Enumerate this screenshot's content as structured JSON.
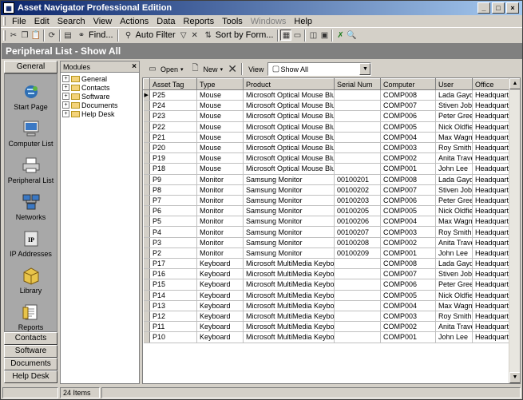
{
  "window": {
    "title": "Asset Navigator Professional Edition",
    "min": "_",
    "max": "□",
    "close": "×"
  },
  "menu": [
    "File",
    "Edit",
    "Search",
    "View",
    "Actions",
    "Data",
    "Reports",
    "Tools",
    "Windows",
    "Help"
  ],
  "toolbar": {
    "find": "Find...",
    "auto_filter": "Auto Filter",
    "sort_by_form": "Sort by Form..."
  },
  "header": {
    "title": "Peripheral List - Show All"
  },
  "leftbar": {
    "top_tab": "General",
    "items": [
      "Start Page",
      "Computer List",
      "Peripheral List",
      "Networks",
      "IP Addresses",
      "Library",
      "Reports"
    ],
    "bottom_tabs": [
      "Contacts",
      "Software",
      "Documents",
      "Help Desk"
    ]
  },
  "modules": {
    "title": "Modules",
    "close": "×",
    "tree": [
      "General",
      "Contacts",
      "Software",
      "Documents",
      "Help Desk"
    ]
  },
  "content_toolbar": {
    "open": "Open",
    "new": "New",
    "view_label": "View",
    "view_value": "Show All"
  },
  "grid": {
    "columns": [
      "Asset Tag",
      "Type",
      "Product",
      "Serial Num",
      "Computer",
      "User",
      "Office"
    ],
    "rows": [
      [
        "P25",
        "Mouse",
        "Microsoft Optical Mouse Blue",
        "",
        "COMP008",
        "Lada Gayday",
        "Headquarters"
      ],
      [
        "P24",
        "Mouse",
        "Microsoft Optical Mouse Blue",
        "",
        "COMP007",
        "Stiven Job",
        "Headquarters"
      ],
      [
        "P23",
        "Mouse",
        "Microsoft Optical Mouse Blue",
        "",
        "COMP006",
        "Peter Green",
        "Headquarters"
      ],
      [
        "P22",
        "Mouse",
        "Microsoft Optical Mouse Blue",
        "",
        "COMP005",
        "Nick Oldfield",
        "Headquarters"
      ],
      [
        "P21",
        "Mouse",
        "Microsoft Optical Mouse Blue",
        "",
        "COMP004",
        "Max Wagner",
        "Headquarters"
      ],
      [
        "P20",
        "Mouse",
        "Microsoft Optical Mouse Blue",
        "",
        "COMP003",
        "Roy Smith",
        "Headquarters"
      ],
      [
        "P19",
        "Mouse",
        "Microsoft Optical Mouse Blue",
        "",
        "COMP002",
        "Anita Travers",
        "Headquarters"
      ],
      [
        "P18",
        "Mouse",
        "Microsoft Optical Mouse Blue",
        "",
        "COMP001",
        "John Lee",
        "Headquarters"
      ],
      [
        "P9",
        "Monitor",
        "Samsung Monitor",
        "00100201",
        "COMP008",
        "Lada Gayday",
        "Headquarters"
      ],
      [
        "P8",
        "Monitor",
        "Samsung Monitor",
        "00100202",
        "COMP007",
        "Stiven Job",
        "Headquarters"
      ],
      [
        "P7",
        "Monitor",
        "Samsung Monitor",
        "00100203",
        "COMP006",
        "Peter Green",
        "Headquarters"
      ],
      [
        "P6",
        "Monitor",
        "Samsung Monitor",
        "00100205",
        "COMP005",
        "Nick Oldfield",
        "Headquarters"
      ],
      [
        "P5",
        "Monitor",
        "Samsung Monitor",
        "00100206",
        "COMP004",
        "Max Wagner",
        "Headquarters"
      ],
      [
        "P4",
        "Monitor",
        "Samsung Monitor",
        "00100207",
        "COMP003",
        "Roy Smith",
        "Headquarters"
      ],
      [
        "P3",
        "Monitor",
        "Samsung Monitor",
        "00100208",
        "COMP002",
        "Anita Travers",
        "Headquarters"
      ],
      [
        "P2",
        "Monitor",
        "Samsung Monitor",
        "00100209",
        "COMP001",
        "John Lee",
        "Headquarters"
      ],
      [
        "P17",
        "Keyboard",
        "Microsoft MultiMedia Keyboard",
        "",
        "COMP008",
        "Lada Gayday",
        "Headquarters"
      ],
      [
        "P16",
        "Keyboard",
        "Microsoft MultiMedia Keyboard",
        "",
        "COMP007",
        "Stiven Job",
        "Headquarters"
      ],
      [
        "P15",
        "Keyboard",
        "Microsoft MultiMedia Keyboard",
        "",
        "COMP006",
        "Peter Green",
        "Headquarters"
      ],
      [
        "P14",
        "Keyboard",
        "Microsoft MultiMedia Keyboard",
        "",
        "COMP005",
        "Nick Oldfield",
        "Headquarters"
      ],
      [
        "P13",
        "Keyboard",
        "Microsoft MultiMedia Keyboard",
        "",
        "COMP004",
        "Max Wagner",
        "Headquarters"
      ],
      [
        "P12",
        "Keyboard",
        "Microsoft MultiMedia Keyboard",
        "",
        "COMP003",
        "Roy Smith",
        "Headquarters"
      ],
      [
        "P11",
        "Keyboard",
        "Microsoft MultiMedia Keyboard",
        "",
        "COMP002",
        "Anita Travers",
        "Headquarters"
      ],
      [
        "P10",
        "Keyboard",
        "Microsoft MultiMedia Keyboard",
        "",
        "COMP001",
        "John Lee",
        "Headquarters"
      ]
    ]
  },
  "status": {
    "items": "24 Items"
  },
  "colors": {
    "title_start": "#0a246a",
    "title_end": "#a6caf0",
    "header_bg": "#808080",
    "face": "#d4d0c8"
  }
}
